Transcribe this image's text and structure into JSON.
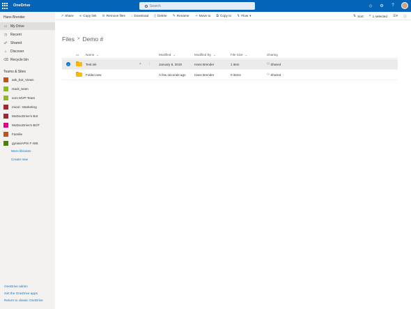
{
  "suite": {
    "app_name": "OneDrive",
    "search_placeholder": "Search"
  },
  "left_nav": {
    "user": "Hans Brender",
    "items": [
      {
        "label": "My Drive",
        "icon": "folder-icon",
        "selected": true
      },
      {
        "label": "Recent",
        "icon": "clock-icon",
        "selected": false
      },
      {
        "label": "Shared",
        "icon": "people-icon",
        "selected": false
      },
      {
        "label": "Discover",
        "icon": "lightbulb-icon",
        "selected": false
      },
      {
        "label": "Recycle bin",
        "icon": "trash-icon",
        "selected": false
      }
    ],
    "section_title": "Teams & Sites",
    "sites": [
      {
        "label": "ask_bot_Views",
        "color": "#ca5010"
      },
      {
        "label": "Hack_team",
        "color": "#8cbd18"
      },
      {
        "label": "som MVP-Team",
        "color": "#8cbd18"
      },
      {
        "label": "mical - Marketing",
        "color": "#a4262c"
      },
      {
        "label": "MoDocDrive's Bot",
        "color": "#a4262c"
      },
      {
        "label": "MoDocDrive's BOT",
        "color": "#e3008c"
      },
      {
        "label": "Familie",
        "color": "#ca5010"
      },
      {
        "label": "gynasiAPIS F-SIB",
        "color": "#498205"
      }
    ],
    "more_sites": "More libraries",
    "create_new": "Create new",
    "footer": [
      "OneDrive admin",
      "Get the OneDrive apps",
      "Return to classic OneDrive"
    ]
  },
  "command_bar": {
    "items": [
      {
        "label": "Share",
        "icon": "share-icon"
      },
      {
        "label": "Copy link",
        "icon": "link-icon"
      },
      {
        "label": "Remove files",
        "icon": "remove-icon"
      },
      {
        "label": "Download",
        "icon": "download-icon"
      },
      {
        "label": "Delete",
        "icon": "delete-icon"
      },
      {
        "label": "Rename",
        "icon": "rename-icon"
      },
      {
        "label": "Move to",
        "icon": "move-icon"
      },
      {
        "label": "Copy to",
        "icon": "copy-icon"
      },
      {
        "label": "Flow",
        "icon": "flow-icon"
      }
    ],
    "sort_label": "Sort",
    "selected_label": "1 selected"
  },
  "breadcrumb": {
    "root": "Files",
    "separator": ">",
    "current": "Demo #"
  },
  "table": {
    "columns": [
      "Name",
      "Modified",
      "Modified By",
      "File Size",
      "Sharing"
    ],
    "rows": [
      {
        "name": "Test.ink",
        "modified": "January 8, 2019",
        "modified_by": "Hans Brender",
        "size": "1 item",
        "sharing": "Shared",
        "selected": true
      },
      {
        "name": "Folder.new",
        "modified": "A few seconds ago",
        "modified_by": "Hans Brender",
        "size": "0 items",
        "sharing": "Shared",
        "selected": false
      }
    ]
  },
  "colors": {
    "suite_bar": "#0364b8",
    "accent": "#0078d4",
    "nav_bg": "#f3f2f1",
    "folder": "#ffb900"
  }
}
